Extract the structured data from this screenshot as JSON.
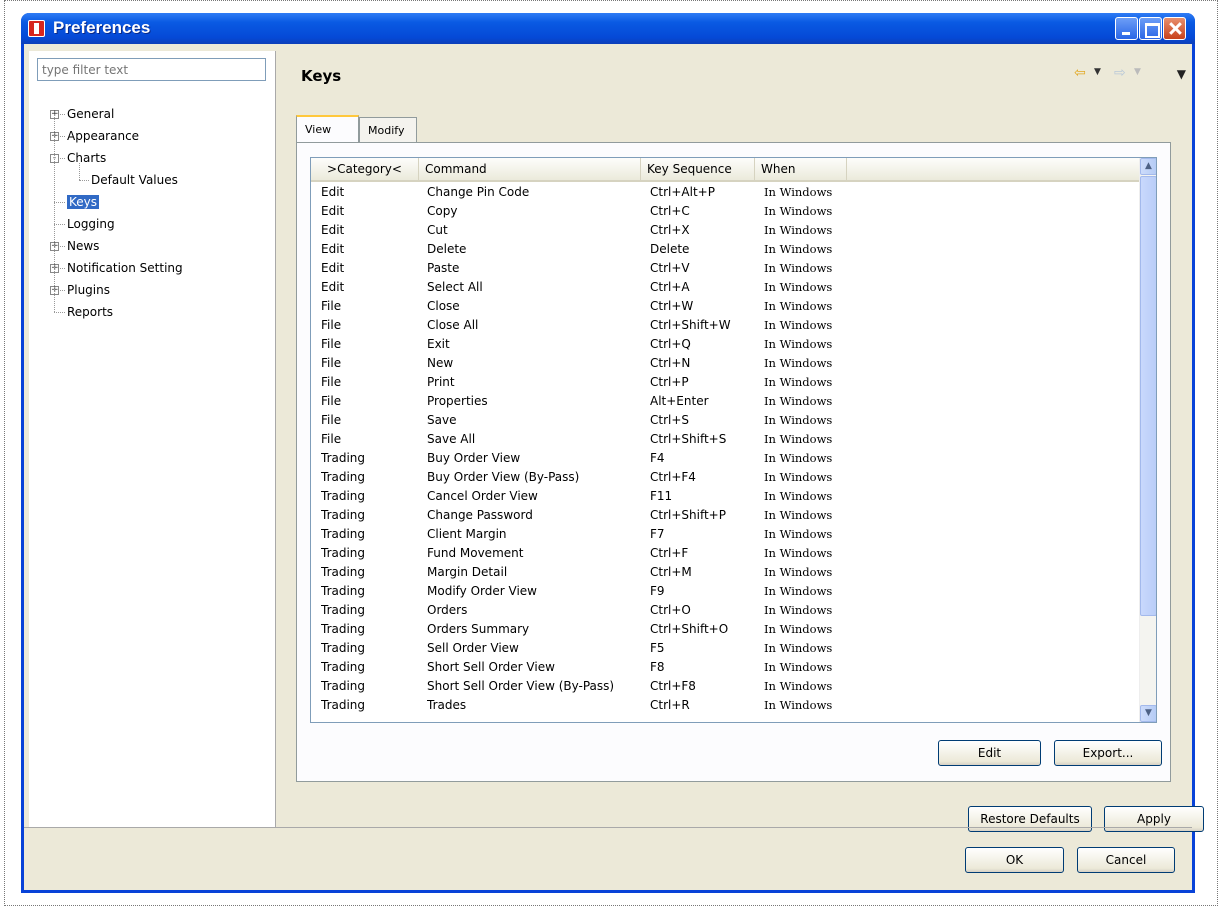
{
  "window": {
    "title": "Preferences"
  },
  "sidebar": {
    "filter_placeholder": "type filter text",
    "items": [
      {
        "label": "General",
        "expander": "+"
      },
      {
        "label": "Appearance",
        "expander": "+"
      },
      {
        "label": "Charts",
        "expander": "-"
      },
      {
        "label": "Default Values",
        "expander": ""
      },
      {
        "label": "Keys",
        "expander": "",
        "selected": true
      },
      {
        "label": "Logging",
        "expander": ""
      },
      {
        "label": "News",
        "expander": "+"
      },
      {
        "label": "Notification Setting",
        "expander": "+"
      },
      {
        "label": "Plugins",
        "expander": "+"
      },
      {
        "label": "Reports",
        "expander": ""
      }
    ]
  },
  "main": {
    "heading": "Keys",
    "tabs": [
      {
        "label": "View",
        "active": true
      },
      {
        "label": "Modify",
        "active": false
      }
    ],
    "table": {
      "columns": [
        ">Category<",
        "Command",
        "Key Sequence",
        "When"
      ],
      "rows": [
        [
          "Edit",
          "Change Pin Code",
          "Ctrl+Alt+P",
          "In Windows"
        ],
        [
          "Edit",
          "Copy",
          "Ctrl+C",
          "In Windows"
        ],
        [
          "Edit",
          "Cut",
          "Ctrl+X",
          "In Windows"
        ],
        [
          "Edit",
          "Delete",
          "Delete",
          "In Windows"
        ],
        [
          "Edit",
          "Paste",
          "Ctrl+V",
          "In Windows"
        ],
        [
          "Edit",
          "Select All",
          "Ctrl+A",
          "In Windows"
        ],
        [
          "File",
          "Close",
          "Ctrl+W",
          "In Windows"
        ],
        [
          "File",
          "Close All",
          "Ctrl+Shift+W",
          "In Windows"
        ],
        [
          "File",
          "Exit",
          "Ctrl+Q",
          "In Windows"
        ],
        [
          "File",
          "New",
          "Ctrl+N",
          "In Windows"
        ],
        [
          "File",
          "Print",
          "Ctrl+P",
          "In Windows"
        ],
        [
          "File",
          "Properties",
          "Alt+Enter",
          "In Windows"
        ],
        [
          "File",
          "Save",
          "Ctrl+S",
          "In Windows"
        ],
        [
          "File",
          "Save All",
          "Ctrl+Shift+S",
          "In Windows"
        ],
        [
          "Trading",
          "Buy Order View",
          "F4",
          "In Windows"
        ],
        [
          "Trading",
          "Buy Order View (By-Pass)",
          "Ctrl+F4",
          "In Windows"
        ],
        [
          "Trading",
          "Cancel Order View",
          "F11",
          "In Windows"
        ],
        [
          "Trading",
          "Change Password",
          "Ctrl+Shift+P",
          "In Windows"
        ],
        [
          "Trading",
          "Client Margin",
          "F7",
          "In Windows"
        ],
        [
          "Trading",
          "Fund Movement",
          "Ctrl+F",
          "In Windows"
        ],
        [
          "Trading",
          "Margin Detail",
          "Ctrl+M",
          "In Windows"
        ],
        [
          "Trading",
          "Modify Order View",
          "F9",
          "In Windows"
        ],
        [
          "Trading",
          "Orders",
          "Ctrl+O",
          "In Windows"
        ],
        [
          "Trading",
          "Orders Summary",
          "Ctrl+Shift+O",
          "In Windows"
        ],
        [
          "Trading",
          "Sell Order View",
          "F5",
          "In Windows"
        ],
        [
          "Trading",
          "Short Sell Order View",
          "F8",
          "In Windows"
        ],
        [
          "Trading",
          "Short Sell Order View (By-Pass)",
          "Ctrl+F8",
          "In Windows"
        ],
        [
          "Trading",
          "Trades",
          "Ctrl+R",
          "In Windows"
        ]
      ]
    },
    "scroll_position": 0.0,
    "buttons": {
      "edit": "Edit",
      "export": "Export...",
      "restore": "Restore Defaults",
      "apply": "Apply"
    }
  },
  "footer": {
    "ok": "OK",
    "cancel": "Cancel"
  },
  "icons": {
    "back": "back-arrow-icon",
    "forward": "forward-arrow-icon",
    "menu": "view-menu-icon"
  },
  "colors": {
    "titlebar": "#0a5ae3",
    "selection": "#316ac5",
    "tab_highlight": "#ffc83c"
  }
}
